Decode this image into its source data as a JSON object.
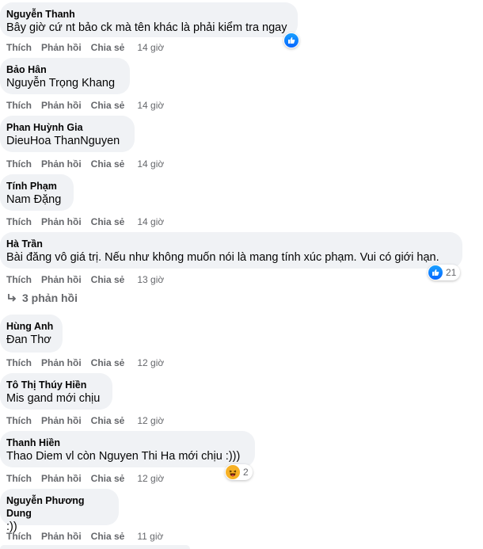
{
  "comments": [
    {
      "author": "Nguyễn Thanh",
      "text": "Bây giờ cứ nt bảo ck mà tên khác là phải kiểm tra ngay",
      "like": "Thích",
      "reply": "Phản hồi",
      "share": "Chia sẻ",
      "time": "14 giờ"
    },
    {
      "author": "Bảo Hân",
      "text": "Nguyễn Trọng Khang",
      "like": "Thích",
      "reply": "Phản hồi",
      "share": "Chia sẻ",
      "time": "14 giờ"
    },
    {
      "author": "Phan Huỳnh Gia",
      "text": "DieuHoa ThanNguyen",
      "like": "Thích",
      "reply": "Phản hồi",
      "share": "Chia sẻ",
      "time": "14 giờ"
    },
    {
      "author": "Tính Phạm",
      "text": "Nam Đặng",
      "like": "Thích",
      "reply": "Phản hồi",
      "share": "Chia sẻ",
      "time": "14 giờ"
    },
    {
      "author": "Hà Trần",
      "text": "Bài đăng vô giá trị. Nếu như không muốn nói là mang tính xúc phạm. Vui có giới hạn.",
      "like": "Thích",
      "reply": "Phản hồi",
      "share": "Chia sẻ",
      "time": "13 giờ",
      "reaction_count": "21",
      "replies_label": "3 phản hồi"
    },
    {
      "author": "Hùng Anh",
      "text": "Đan Thơ",
      "like": "Thích",
      "reply": "Phản hồi",
      "share": "Chia sẻ",
      "time": "12 giờ"
    },
    {
      "author": "Tô Thị Thúy Hiền",
      "text": "Mis gand mới chịu",
      "like": "Thích",
      "reply": "Phản hồi",
      "share": "Chia sẻ",
      "time": "12 giờ"
    },
    {
      "author": "Thanh Hiền",
      "text": "Thao Diem vl còn Nguyen Thi Ha mới chịu :)))",
      "like": "Thích",
      "reply": "Phản hồi",
      "share": "Chia sẻ",
      "time": "12 giờ",
      "reaction_count": "2"
    },
    {
      "author": "Nguyễn Phương Dung",
      "text": ":))",
      "like": "Thích",
      "reply": "Phản hồi",
      "share": "Chia sẻ",
      "time": "11 giờ"
    }
  ],
  "icons": {
    "like": "like-reaction-icon",
    "haha": "haha-reaction-icon",
    "reply_arrow": "reply-arrow-icon"
  },
  "colors": {
    "bubble": "#f0f2f5",
    "secondary_text": "#65676b",
    "like_blue": "#0866ff",
    "haha_yellow": "#f7b125"
  }
}
